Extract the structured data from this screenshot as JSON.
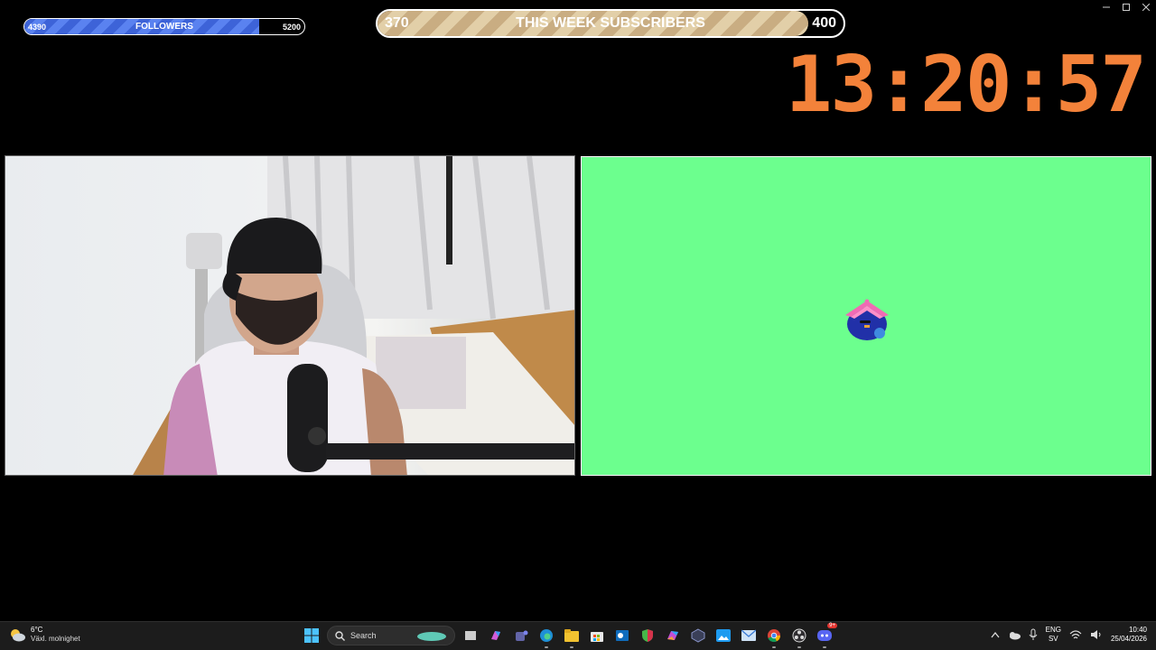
{
  "followers_bar": {
    "current": "4390",
    "label": "FOLLOWERS",
    "goal": "5200",
    "progress": 0.84
  },
  "subscribers_bar": {
    "current": "370",
    "label": "THIS WEEK SUBSCRIBERS",
    "goal": "400",
    "progress": 0.925
  },
  "countdown": {
    "text": "13:20:57",
    "color": "#f3823a"
  },
  "green_screen": {
    "color": "#6cff8e"
  },
  "taskbar": {
    "weather": {
      "temp": "6°C",
      "desc": "Växl. molnighet"
    },
    "search": {
      "placeholder": "Search"
    },
    "apps": [
      "start-icon",
      "search",
      "file-explorer-icon",
      "copilot-icon",
      "teams-icon",
      "edge-icon",
      "folder-icon",
      "store-icon",
      "outlook-icon",
      "shield-icon",
      "m365-icon",
      "vpn-icon",
      "photos-icon",
      "mail-icon",
      "chrome-icon",
      "obs-icon",
      "discord-icon"
    ],
    "discord_badge": "9+",
    "tray": {
      "lang1": "ENG",
      "lang2": "SV",
      "time": "10:40",
      "date": "25/04/2026"
    }
  }
}
